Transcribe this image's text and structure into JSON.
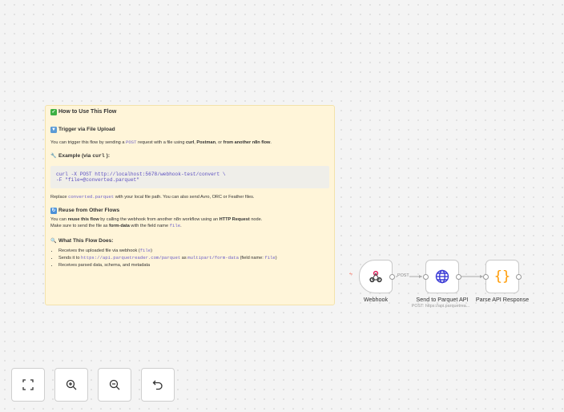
{
  "note": {
    "title": "How to Use This Flow",
    "s1_title": "Trigger via File Upload",
    "s1_p": [
      "You can trigger this flow by sending a ",
      "POST",
      " request with a file using ",
      "curl",
      ", ",
      "Postman",
      ", or ",
      "from another n8n flow",
      "."
    ],
    "s2_title_a": "Example (via ",
    "s2_title_code": "curl",
    "s2_title_b": "):",
    "code_block": "curl -X POST http://localhost:5678/webhook-test/convert \\\n-F \"file=@converted.parquet\"",
    "s2_p": [
      "Replace ",
      "converted.parquet",
      " with your local file path. You can also send Avro, ORC or Feather files."
    ],
    "s3_title": "Reuse from Other Flows",
    "s3_p": [
      "You can ",
      "reuse this flow",
      " by calling the webhook from another n8n workflow using an ",
      "HTTP Request",
      " node."
    ],
    "s3_p2": [
      "Make sure to send the file as ",
      "form-data",
      " with the field name ",
      "file",
      "."
    ],
    "s4_title": "What This Flow Does:",
    "li1": [
      "Receives the uploaded file via webhook (",
      "file",
      ")"
    ],
    "li2": [
      "Sends it to ",
      "https://api.parquetreader.com/parquet",
      " as ",
      "multipart/form-data",
      " (field name: ",
      "file",
      ")"
    ],
    "li3": "Receives parsed data, schema, and metadata"
  },
  "nodes": [
    {
      "label": "Webhook",
      "icon": "webhook-icon"
    },
    {
      "label": "Send to Parquet API",
      "subtitle": "POST: https://api.parquetrea...",
      "icon": "globe-icon"
    },
    {
      "label": "Parse API Response",
      "icon": "code-braces-icon"
    }
  ],
  "connection_label": "POST",
  "controls": [
    "zoom-to-fit",
    "zoom-in",
    "zoom-out",
    "undo"
  ],
  "colors": {
    "note_bg": "#fff5d9",
    "trigger": "#ff6d5a",
    "code_orange": "#ff9900",
    "globe": "#3b3bd6"
  }
}
